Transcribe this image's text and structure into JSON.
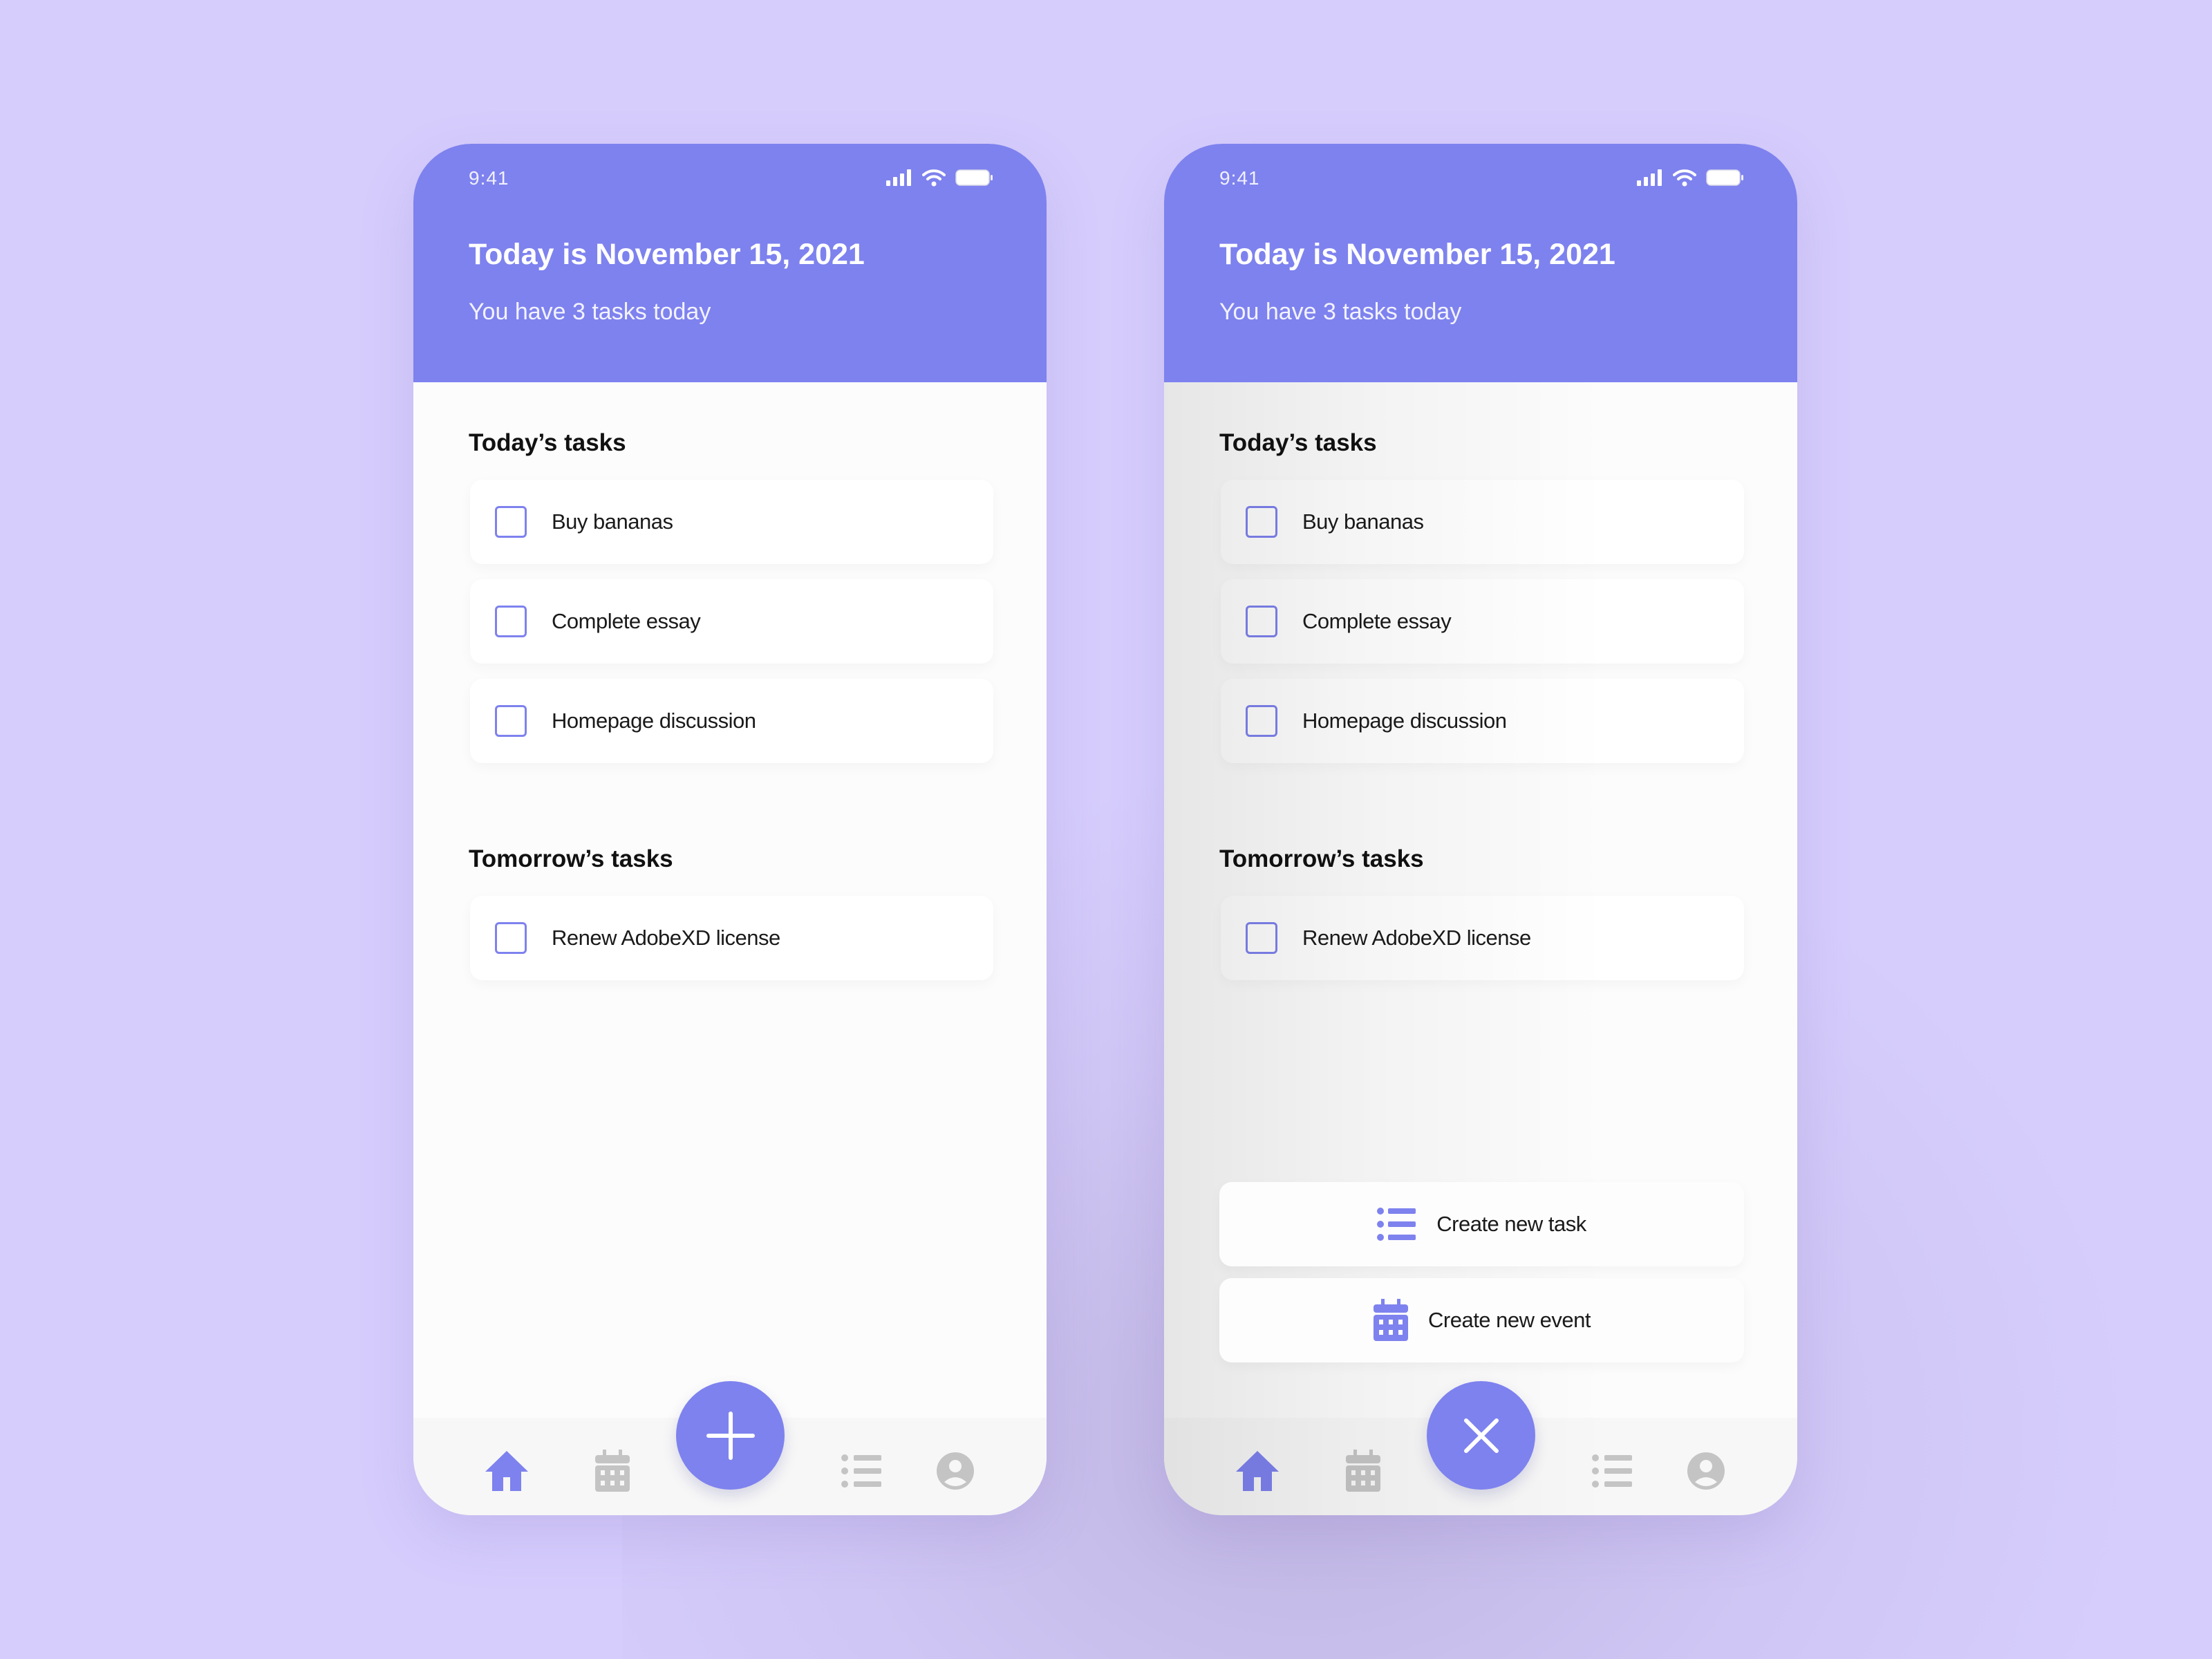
{
  "colors": {
    "background": "#d6cdfd",
    "accent": "#7e82ee",
    "inactive_icon": "#c4c4c4"
  },
  "screens": [
    {
      "status": {
        "time": "9:41"
      },
      "header": {
        "title": "Today is November 15, 2021",
        "subtitle": "You have 3 tasks today"
      },
      "today": {
        "title": "Today’s tasks",
        "tasks": [
          {
            "label": "Buy bananas",
            "checked": false
          },
          {
            "label": "Complete essay",
            "checked": false
          },
          {
            "label": "Homepage discussion",
            "checked": false
          }
        ]
      },
      "tomorrow": {
        "title": "Tomorrow’s tasks",
        "tasks": [
          {
            "label": "Renew AdobeXD license",
            "checked": false
          }
        ]
      },
      "nav": {
        "items": [
          "home-icon",
          "calendar-icon",
          "list-icon",
          "profile-icon"
        ],
        "active": "home-icon",
        "fab_icon": "plus-icon"
      }
    },
    {
      "status": {
        "time": "9:41"
      },
      "header": {
        "title": "Today is November 15, 2021",
        "subtitle": "You have 3 tasks today"
      },
      "today": {
        "title": "Today’s tasks",
        "tasks": [
          {
            "label": "Buy bananas",
            "checked": false
          },
          {
            "label": "Complete essay",
            "checked": false
          },
          {
            "label": "Homepage discussion",
            "checked": false
          }
        ]
      },
      "tomorrow": {
        "title": "Tomorrow’s tasks",
        "tasks": [
          {
            "label": "Renew AdobeXD license",
            "checked": false
          }
        ]
      },
      "fab_menu": [
        {
          "label": "Create new task",
          "icon": "list-icon"
        },
        {
          "label": "Create new event",
          "icon": "calendar-icon"
        }
      ],
      "nav": {
        "items": [
          "home-icon",
          "calendar-icon",
          "list-icon",
          "profile-icon"
        ],
        "active": "home-icon",
        "fab_icon": "close-icon"
      }
    }
  ]
}
